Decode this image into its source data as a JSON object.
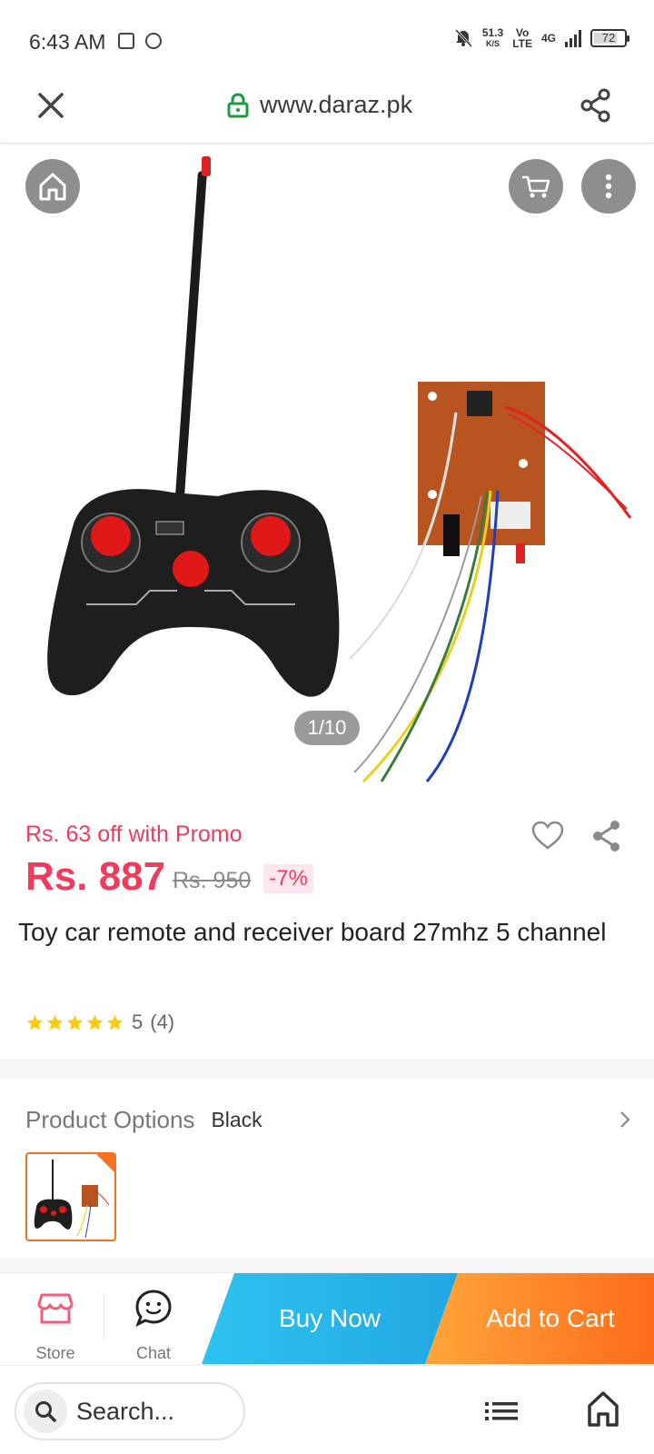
{
  "status_bar": {
    "time": "6:43 AM",
    "net_speed_value": "51.3",
    "net_speed_unit": "K/S",
    "volte_top": "Vo",
    "volte_bottom": "LTE",
    "network": "4G",
    "battery_percent": "72"
  },
  "browser": {
    "url": "www.daraz.pk"
  },
  "gallery": {
    "counter": "1/10",
    "current_index": 1,
    "total": 10
  },
  "product": {
    "promo_text": "Rs. 63 off with Promo",
    "price": "Rs. 887",
    "original_price": "Rs. 950",
    "discount": "-7%",
    "title": "Toy car remote and receiver board 27mhz 5 channel",
    "rating": 5,
    "rating_label": "5",
    "review_count": "(4)"
  },
  "options": {
    "label": "Product Options",
    "selected_value": "Black"
  },
  "actions": {
    "store_label": "Store",
    "chat_label": "Chat",
    "buy_now_label": "Buy Now",
    "add_to_cart_label": "Add to Cart"
  },
  "bottom_bar": {
    "search_placeholder": "Search..."
  },
  "colors": {
    "price_red": "#f23b5c",
    "buy_now_blue": "#26b5e8",
    "add_cart_orange": "#ff8a2a",
    "store_pink": "#f25c7a"
  }
}
